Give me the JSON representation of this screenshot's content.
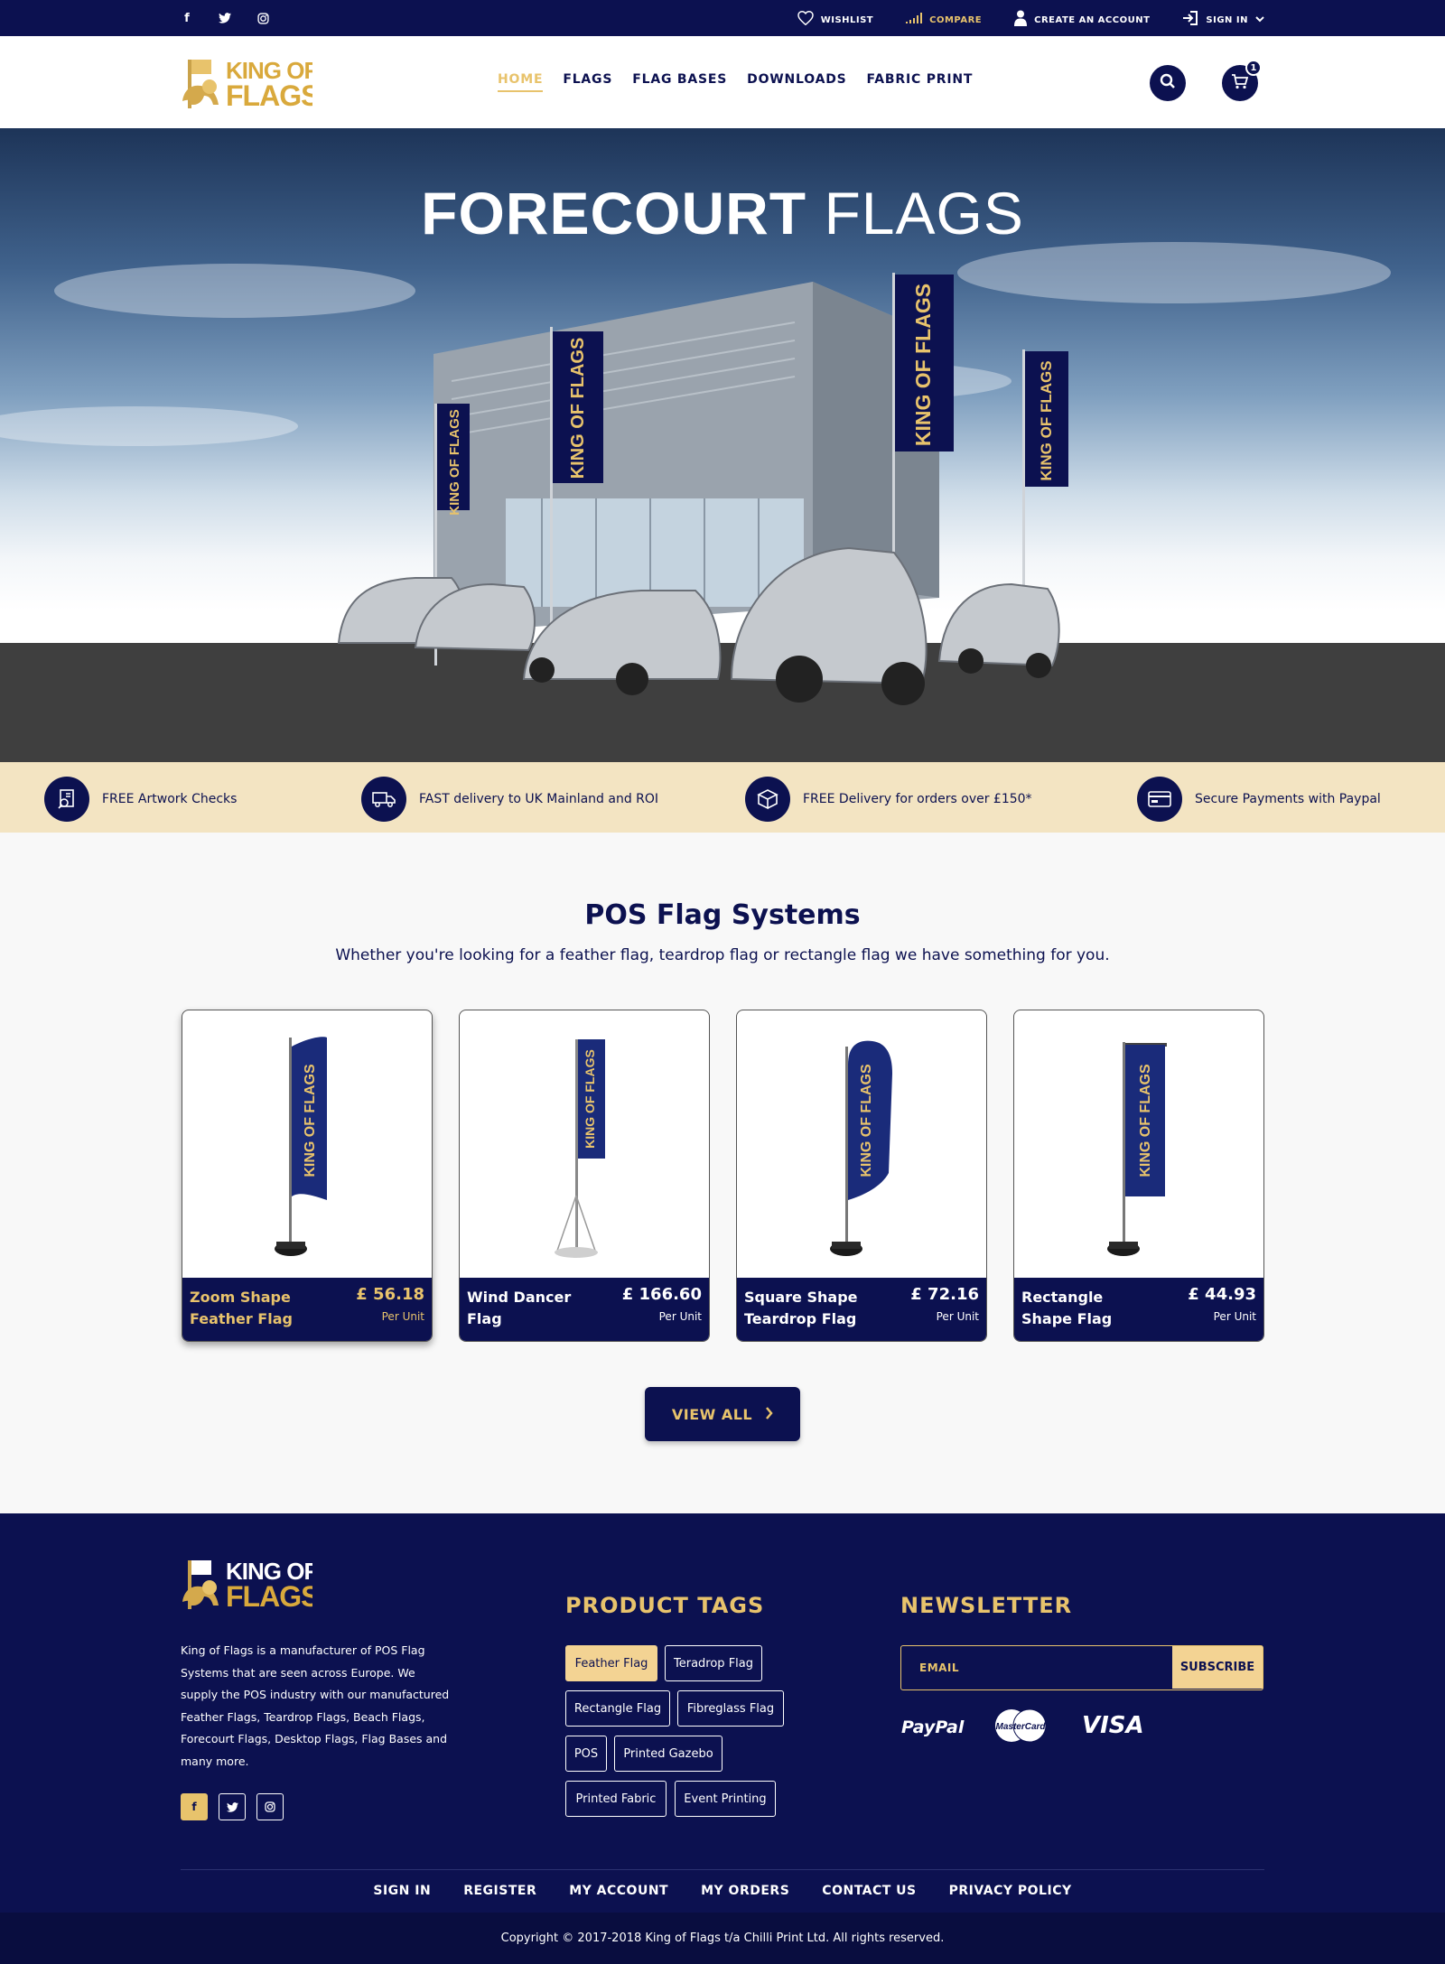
{
  "topbar": {
    "social": [
      {
        "icon": "facebook-icon",
        "glyph": "f"
      },
      {
        "icon": "twitter-icon",
        "glyph": "🐦"
      },
      {
        "icon": "instagram-icon",
        "glyph": "◎"
      }
    ],
    "wishlist": "WISHLIST",
    "compare": "COMPARE",
    "create_account": "CREATE AN ACCOUNT",
    "sign_in": "SIGN IN"
  },
  "header": {
    "logo_text": "KING OF FLAGS",
    "nav": [
      "HOME",
      "FLAGS",
      "FLAG BASES",
      "DOWNLOADS",
      "FABRIC PRINT"
    ],
    "cart_count": "1"
  },
  "hero": {
    "title_bold": "FORECOURT",
    "title_light": "FLAGS",
    "flag_text": "KING OF FLAGS"
  },
  "features": [
    {
      "icon": "artwork-icon",
      "text": "FREE Artwork Checks"
    },
    {
      "icon": "truck-icon",
      "text": "FAST delivery to UK Mainland and ROI"
    },
    {
      "icon": "box-icon",
      "text": "FREE Delivery for orders over £150*"
    },
    {
      "icon": "card-icon",
      "text": "Secure Payments with Paypal"
    }
  ],
  "section": {
    "title": "POS Flag Systems",
    "subtitle": "Whether you're looking for a feather flag, teardrop flag or rectangle flag we have something for you."
  },
  "products": [
    {
      "name": "Zoom Shape Feather Flag",
      "price": "£ 56.18",
      "unit": "Per Unit",
      "shape": "feather"
    },
    {
      "name": "Wind Dancer Flag",
      "price": "£ 166.60",
      "unit": "Per Unit",
      "shape": "winddancer"
    },
    {
      "name": "Square Shape Teardrop Flag",
      "price": "£ 72.16",
      "unit": "Per Unit",
      "shape": "teardrop"
    },
    {
      "name": "Rectangle Shape Flag",
      "price": "£ 44.93",
      "unit": "Per Unit",
      "shape": "rectangle"
    }
  ],
  "view_all": "VIEW ALL",
  "footer": {
    "description": "King of Flags is a manufacturer of POS Flag Systems that are seen across Europe. We supply the POS industry with our manufactured Feather Flags, Teardrop Flags, Beach Flags, Forecourt Flags, Desktop Flags, Flag Bases and many more.",
    "product_tags_heading": "PRODUCT TAGS",
    "tags": [
      "Feather Flag",
      "Teradrop Flag",
      "Rectangle Flag",
      "Fibreglass Flag",
      "POS",
      "Printed Gazebo",
      "Printed Fabric",
      "Event Printing"
    ],
    "newsletter_heading": "NEWSLETTER",
    "email_placeholder": "EMAIL",
    "subscribe": "SUBSCRIBE",
    "payments": [
      "PayPal",
      "MasterCard",
      "VISA"
    ],
    "links": [
      "SIGN IN",
      "REGISTER",
      "MY ACCOUNT",
      "MY ORDERS",
      "CONTACT US",
      "PRIVACY POLICY"
    ],
    "copyright": "Copyright © 2017-2018 King of Flags t/a Chilli Print Ltd. All rights reserved."
  },
  "colors": {
    "navy": "#0c1150",
    "gold": "#e8c36c",
    "cream": "#f3e4c2"
  }
}
